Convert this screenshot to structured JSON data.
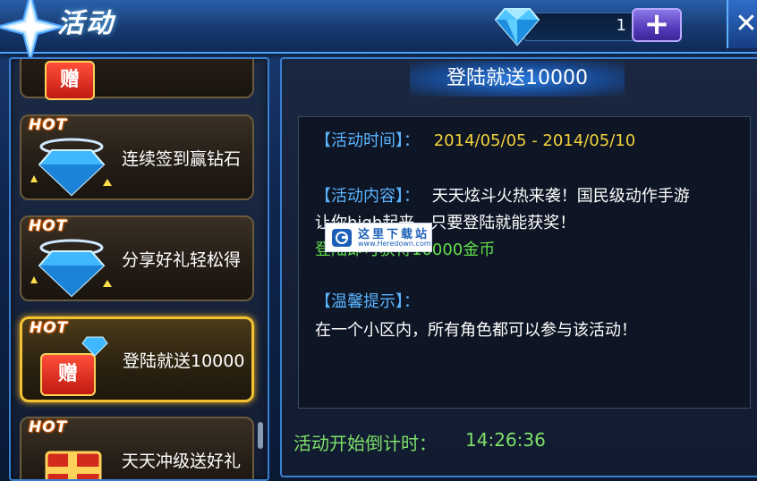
{
  "window": {
    "title": "活动",
    "diamond_count": "1",
    "plus_label": "+",
    "close_label": "✕"
  },
  "activity_list": [
    {
      "label": "",
      "badge": "",
      "icon": "gift-icon",
      "gift_text": "赠"
    },
    {
      "label": "连续签到赢钻石",
      "badge": "HOT",
      "icon": "diamond-icon"
    },
    {
      "label": "分享好礼轻松得",
      "badge": "HOT",
      "icon": "diamond-icon"
    },
    {
      "label": "登陆就送10000",
      "badge": "HOT",
      "icon": "gift-icon",
      "gift_text": "赠",
      "selected": true
    },
    {
      "label": "天天冲级送好礼",
      "badge": "HOT",
      "icon": "gift-box-icon"
    }
  ],
  "detail": {
    "title": "登陆就送10000",
    "time_label": "【活动时间】：",
    "time_value": "2014/05/05 - 2014/05/10",
    "content_label": "【活动内容】：",
    "content_line1": "天天炫斗火热来袭！国民级动作手游",
    "content_line2": "让你high起来，只要登陆就能获奖！",
    "content_line3": "登陆即可获得10000金币",
    "tip_label": "【温馨提示】：",
    "tip_text": "在一个小区内，所有角色都可以参与该活动！",
    "countdown_label": "活动开始倒计时：",
    "countdown_value": "14:26:36"
  },
  "watermark": {
    "title": "这里下载站",
    "url": "www.Heredown.com"
  },
  "colors": {
    "accent_blue": "#3a7fd0",
    "selected_gold": "#f3c233",
    "label_blue": "#5ab4ff",
    "date_yellow": "#f3d33a",
    "countdown_green": "#7ee06a"
  }
}
